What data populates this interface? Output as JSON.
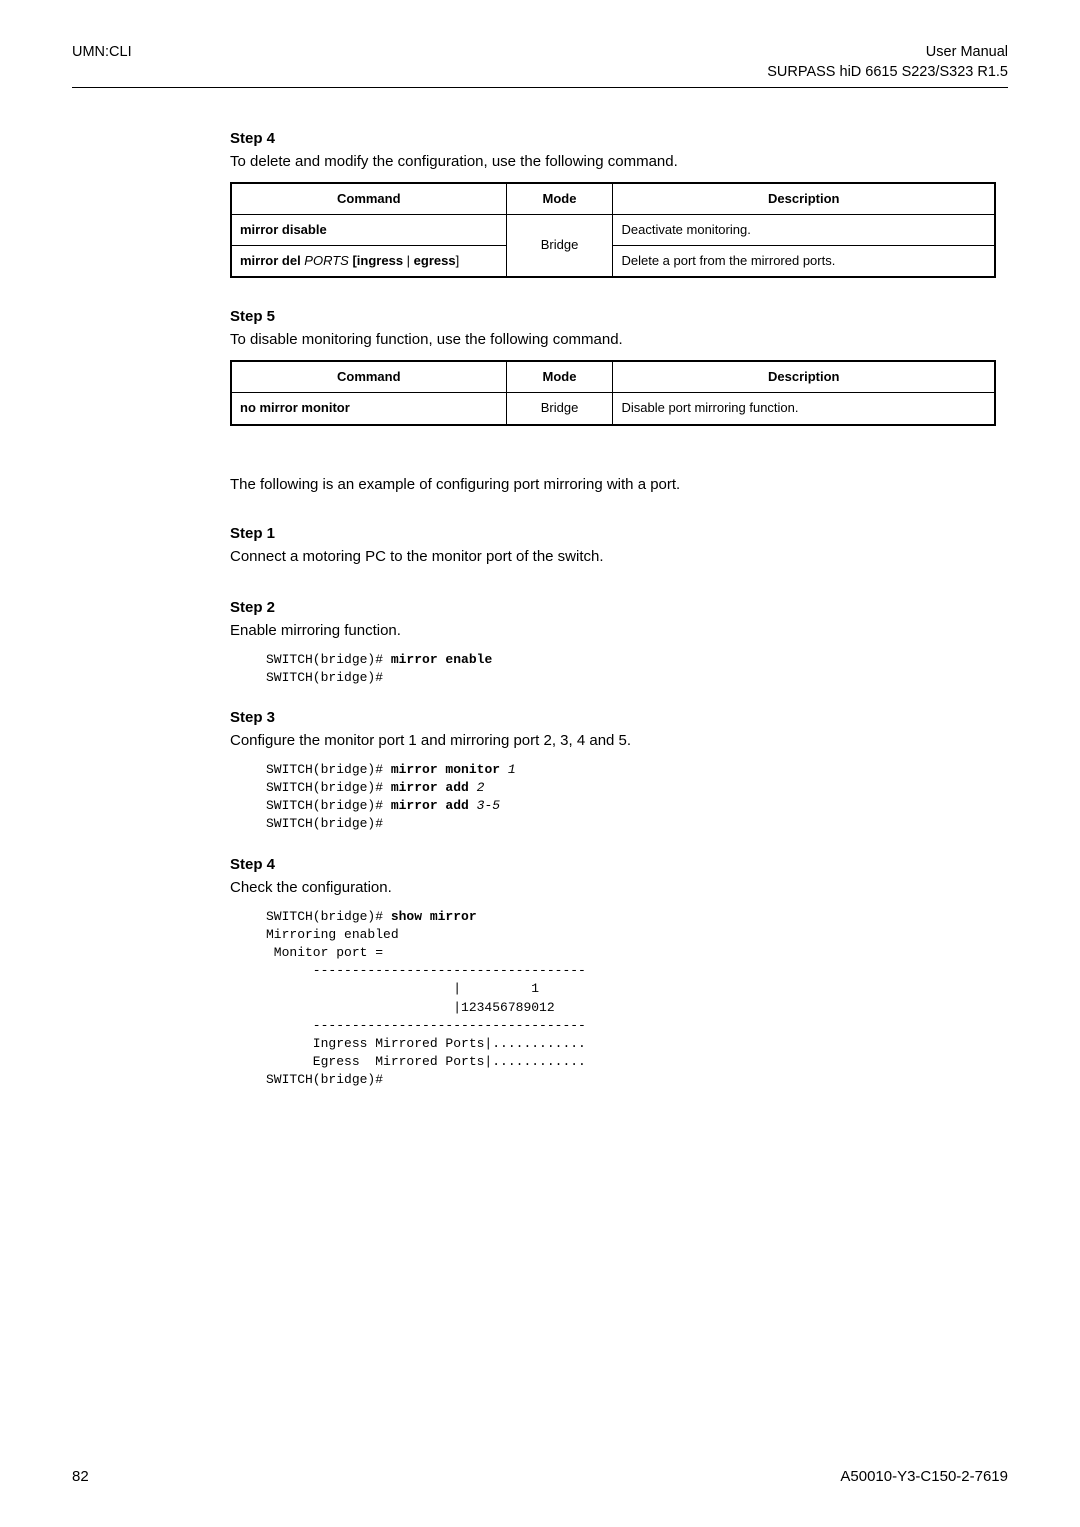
{
  "header": {
    "left": "UMN:CLI",
    "right_line1": "User Manual",
    "right_line2": "SURPASS hiD 6615 S223/S323 R1.5"
  },
  "s4": {
    "title": "Step 4",
    "desc": "To delete and modify the configuration, use the following command."
  },
  "t1": {
    "h_cmd": "Command",
    "h_mode": "Mode",
    "h_desc": "Description",
    "r1_cmd": "mirror disable",
    "r1_desc": "Deactivate monitoring.",
    "r2_cmd_a": "mirror del ",
    "r2_cmd_b": "PORTS",
    "r2_cmd_c": " [ingress ",
    "r2_cmd_d": "| ",
    "r2_cmd_e": "egress",
    "r2_cmd_f": "]",
    "mode": "Bridge",
    "r2_desc": "Delete a port from the mirrored ports."
  },
  "s5": {
    "title": "Step 5",
    "desc": "To disable monitoring function, use the following command."
  },
  "t2": {
    "h_cmd": "Command",
    "h_mode": "Mode",
    "h_desc": "Description",
    "r1_cmd": "no mirror monitor",
    "mode": "Bridge",
    "r1_desc": "Disable port mirroring function."
  },
  "intro_example": "The following is an example of configuring port mirroring with a port.",
  "s1": {
    "title": "Step 1",
    "desc": "Connect a motoring PC to the monitor port of the switch."
  },
  "s2": {
    "title": "Step 2",
    "desc": "Enable mirroring function."
  },
  "code2": {
    "l1a": "SWITCH(bridge)# ",
    "l1b": "mirror enable",
    "l2": "SWITCH(bridge)#"
  },
  "s3": {
    "title": "Step 3",
    "desc": "Configure the monitor port 1 and mirroring port 2, 3, 4 and 5."
  },
  "code3": {
    "l1a": "SWITCH(bridge)# ",
    "l1b": "mirror monitor ",
    "l1c": "1",
    "l2a": "SWITCH(bridge)# ",
    "l2b": "mirror add ",
    "l2c": "2",
    "l3a": "SWITCH(bridge)# ",
    "l3b": "mirror add ",
    "l3c": "3-5",
    "l4": "SWITCH(bridge)#"
  },
  "s4b": {
    "title": "Step 4",
    "desc": "Check the configuration."
  },
  "code4": {
    "l1a": "SWITCH(bridge)# ",
    "l1b": "show mirror",
    "l2": "Mirroring enabled",
    "l3": " Monitor port =",
    "l4": "      -----------------------------------",
    "l5": "                        |         1",
    "l6": "                        |123456789012",
    "l7": "      -----------------------------------",
    "l8": "      Ingress Mirrored Ports|............",
    "l9": "      Egress  Mirrored Ports|............",
    "l10": "SWITCH(bridge)#"
  },
  "footer": {
    "left": "82",
    "right": "A50010-Y3-C150-2-7619"
  }
}
